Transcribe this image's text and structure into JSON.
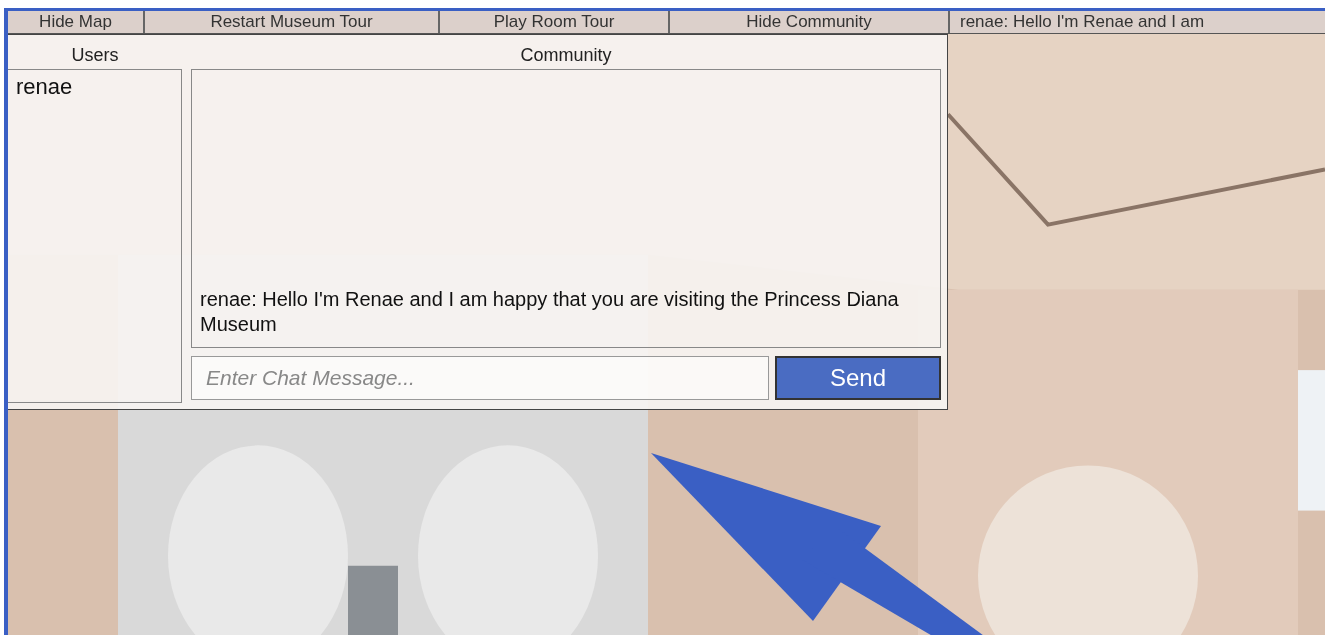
{
  "toolbar": {
    "buttons": [
      "Hide Map",
      "Restart Museum Tour",
      "Play Room Tour",
      "Hide Community"
    ],
    "ticker": "renae: Hello I'm Renae and I am"
  },
  "community": {
    "users_title": "Users",
    "users": [
      {
        "name": "renae"
      }
    ],
    "title": "Community",
    "messages": [
      "renae: Hello I'm Renae and I am happy that you are visiting the Princess Diana Museum"
    ],
    "input": {
      "placeholder": "Enter Chat Message..."
    },
    "send": "Send"
  }
}
